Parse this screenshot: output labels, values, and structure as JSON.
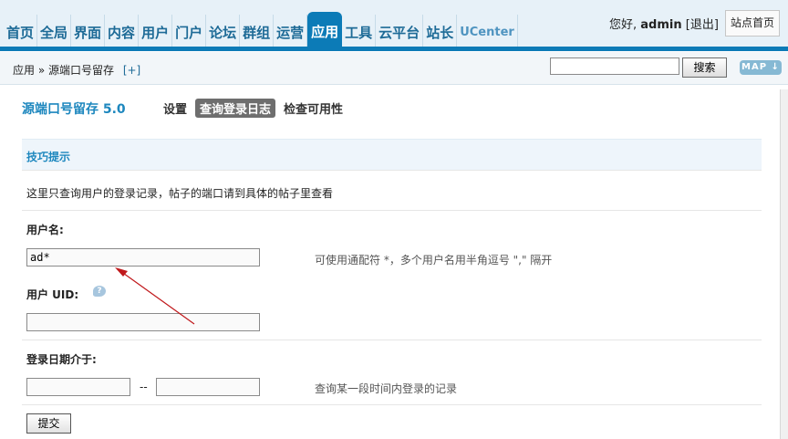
{
  "nav": {
    "items": [
      "首页",
      "全局",
      "界面",
      "内容",
      "用户",
      "门户",
      "论坛",
      "群组",
      "运营",
      "应用",
      "工具",
      "云平台",
      "站长",
      "UCenter"
    ],
    "active": "应用"
  },
  "header": {
    "greeting_prefix": "您好,",
    "username": "admin",
    "logout": "[退出]",
    "site_home": "站点首页"
  },
  "breadcrumb": {
    "path": "应用 » 源端口号留存",
    "add": "[+]"
  },
  "search": {
    "value": "",
    "button": "搜索"
  },
  "map_button": "MAP ↓",
  "plugin": {
    "title": "源端口号留存 5.0",
    "tabs": [
      "设置",
      "查询登录日志",
      "检查可用性"
    ],
    "current_tab": "查询登录日志"
  },
  "tips": {
    "title": "技巧提示",
    "text": "这里只查询用户的登录记录，帖子的端口请到具体的帖子里查看"
  },
  "form": {
    "username_label": "用户名:",
    "username_value": "ad*",
    "username_hint": "可使用通配符 *，多个用户名用半角逗号 \",\" 隔开",
    "uid_label": "用户  UID:",
    "uid_help": "?",
    "uid_value": "",
    "date_label": "登录日期介于:",
    "date_from": "",
    "date_sep": "--",
    "date_to": "",
    "date_hint": "查询某一段时间内登录的记录",
    "submit": "提交"
  },
  "colors": {
    "nav_active": "#0c7bb7",
    "title_blue": "#1d87be",
    "annotation_arrow": "#c0181b"
  }
}
